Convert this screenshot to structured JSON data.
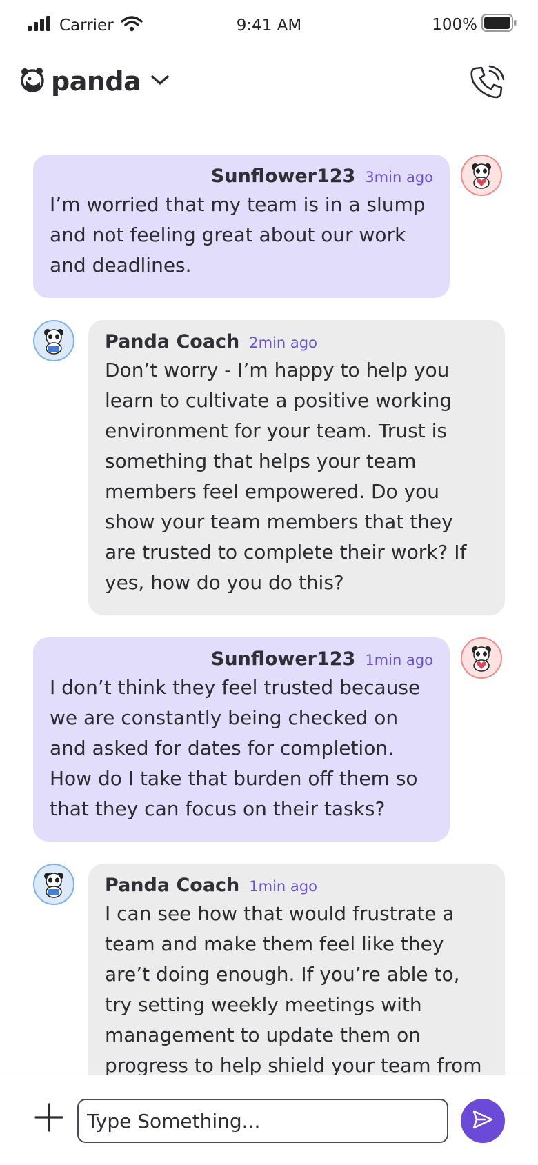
{
  "status_bar": {
    "carrier": "Carrier",
    "time": "9:41 AM",
    "battery": "100%"
  },
  "header": {
    "brand": "panda",
    "logo_icon": "panda-logo-icon",
    "dropdown_icon": "chevron-down-icon",
    "call_icon": "phone-call-icon"
  },
  "colors": {
    "accent": "#6a4ad7",
    "user_bubble": "#e1ddfb",
    "coach_bubble": "#ececec",
    "timestamp": "#6a52d6"
  },
  "messages": [
    {
      "author": "Sunflower123",
      "time": "3min ago",
      "text": "I’m worried that my team is in a slump and not feeling great about our work and deadlines.",
      "avatar_icon": "panda-heart-avatar-icon"
    },
    {
      "author": "Panda Coach",
      "time": "2min ago",
      "text": "Don’t worry - I’m happy to help you learn to cultivate a positive working environment for your team. Trust is something that helps your team members feel empowered. Do you show your team members that they are trusted to complete their work? If yes, how do you do this?",
      "avatar_icon": "panda-laptop-avatar-icon"
    },
    {
      "author": "Sunflower123",
      "time": "1min ago",
      "text": "I don’t think they feel trusted because we are constantly being checked on and asked for dates for completion. How do I take that burden off them so that they can focus on their tasks?",
      "avatar_icon": "panda-heart-avatar-icon"
    },
    {
      "author": "Panda Coach",
      "time": "1min ago",
      "text": "I can see how that would frustrate a team and make them feel like they are’t doing enough. If you’re able to, try setting weekly meetings with management to update them on progress to help shield your team from",
      "avatar_icon": "panda-laptop-avatar-icon"
    }
  ],
  "composer": {
    "add_icon": "plus-icon",
    "placeholder": "Type Something...",
    "value": "",
    "send_icon": "send-icon"
  }
}
